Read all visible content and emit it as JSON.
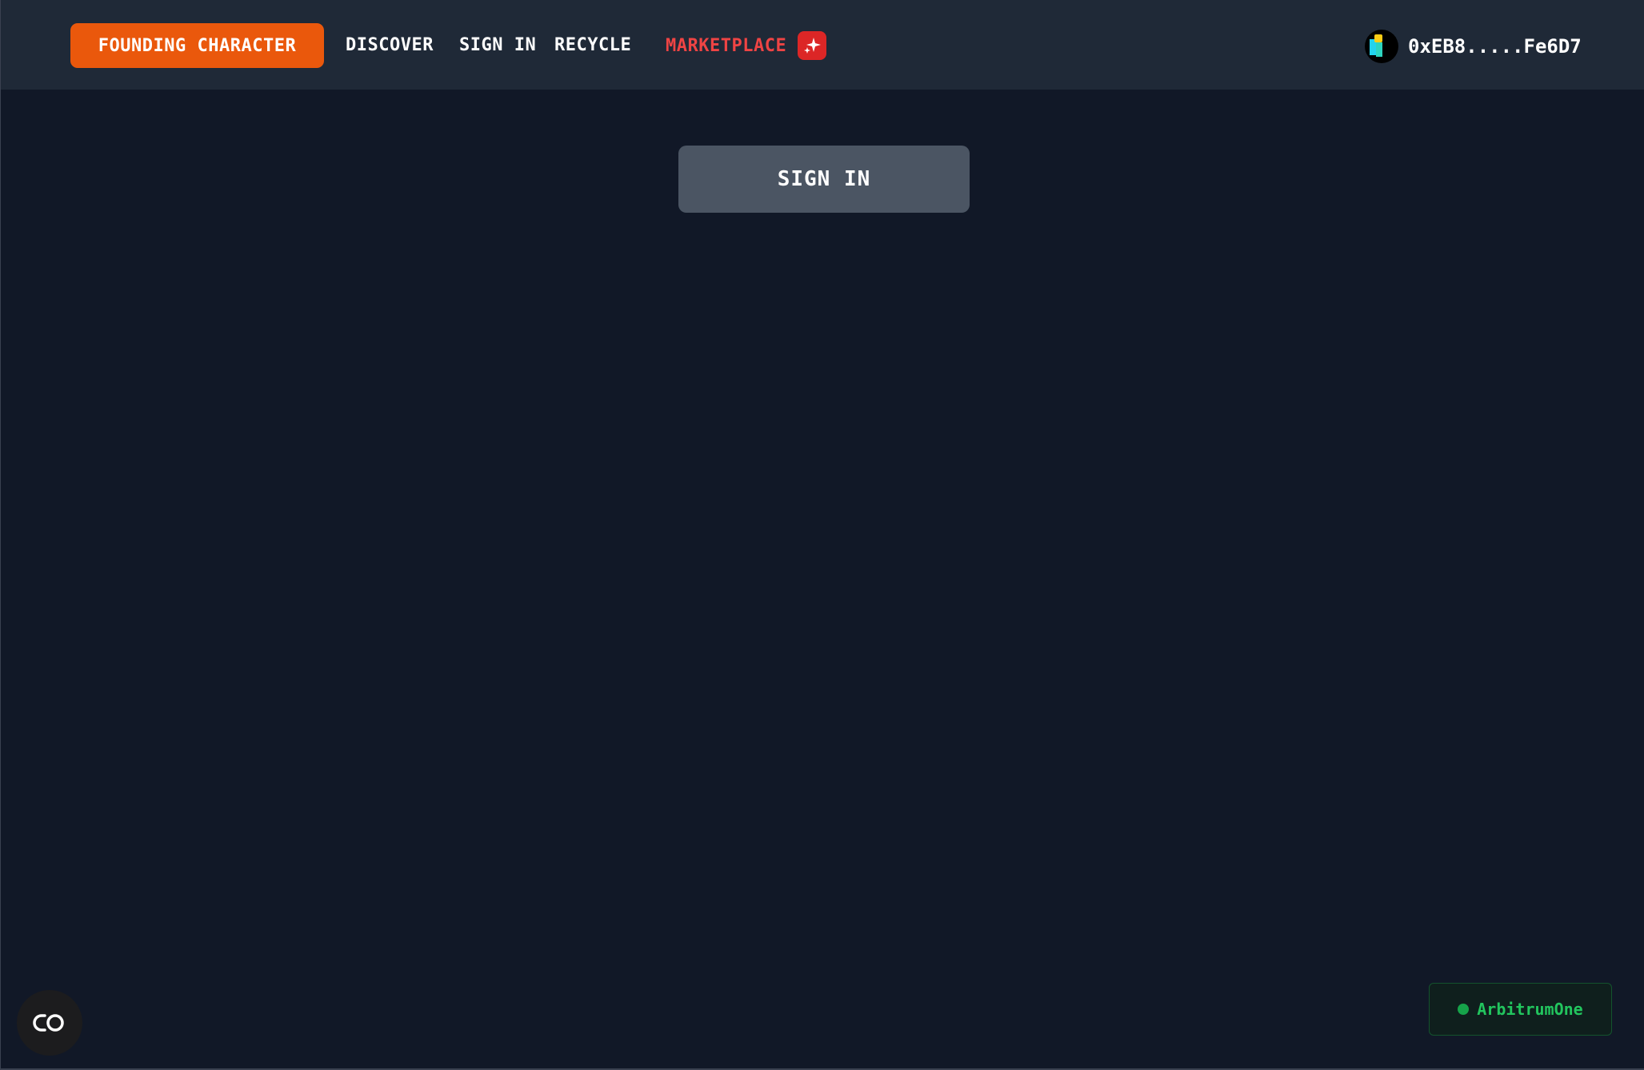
{
  "nav": {
    "founding_label": "FOUNDING CHARACTER",
    "discover_label": "DISCOVER",
    "signin_label": "SIGN IN",
    "recycle_label": "RECYCLE",
    "marketplace_label": "MARKETPLACE",
    "marketplace_icon": "sparkle-icon"
  },
  "wallet": {
    "address": "0xEB8.....Fe6D7",
    "avatar_icon": "wallet-avatar"
  },
  "main": {
    "signin_button_label": "SIGN IN"
  },
  "floating": {
    "icon": "link-icon"
  },
  "network": {
    "label": "ArbitrumOne",
    "status_color": "#16a34a"
  },
  "colors": {
    "background": "#111827",
    "navbar": "#1f2937",
    "accent_orange": "#ea580c",
    "marketplace_red": "#ef4444",
    "button_gray": "#4b5563",
    "network_green": "#22c55e"
  }
}
